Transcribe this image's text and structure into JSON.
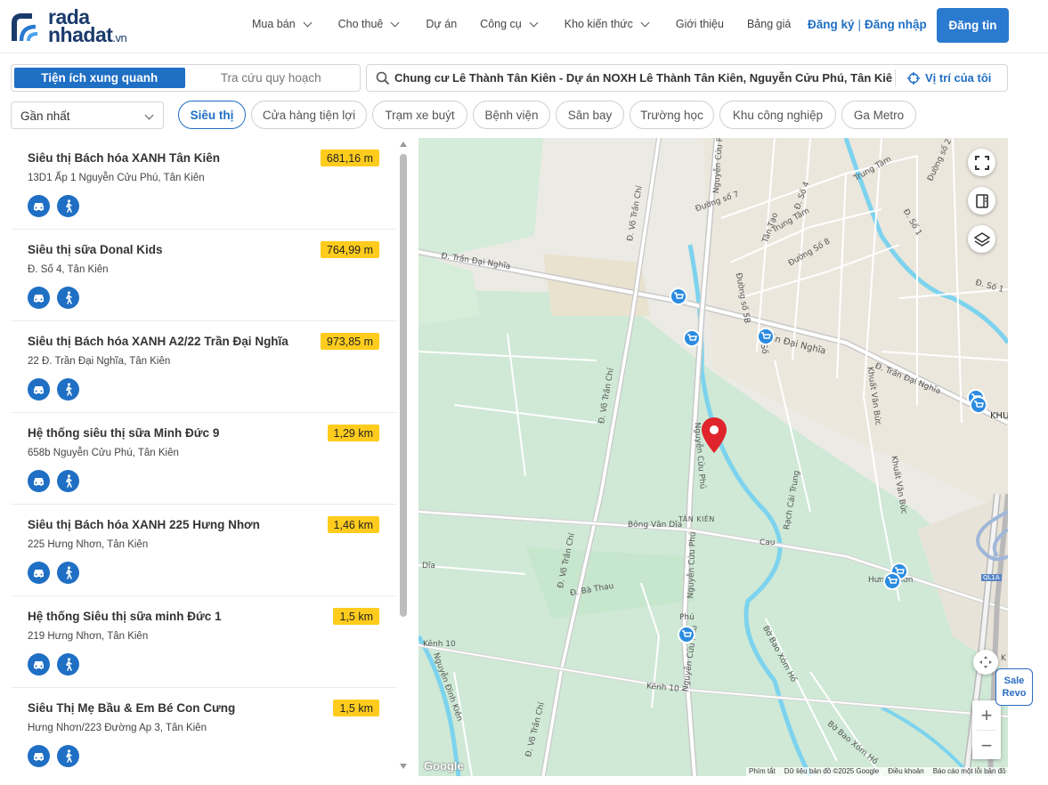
{
  "header": {
    "logo_line1": "rada",
    "logo_line2": "nhadat",
    "logo_suffix": ".vn",
    "nav": [
      {
        "label": "Mua bán",
        "has_dropdown": true
      },
      {
        "label": "Cho thuê",
        "has_dropdown": true
      },
      {
        "label": "Dự án",
        "has_dropdown": false
      },
      {
        "label": "Công cụ",
        "has_dropdown": true
      },
      {
        "label": "Kho kiến thức",
        "has_dropdown": true
      },
      {
        "label": "Giới thiệu",
        "has_dropdown": false
      },
      {
        "label": "Bảng giá",
        "has_dropdown": false
      }
    ],
    "register": "Đăng ký",
    "separator": "|",
    "login": "Đăng nhập",
    "post_button": "Đăng tin"
  },
  "toolbar": {
    "tab_active": "Tiện ích xung quanh",
    "tab_inactive": "Tra cứu quy hoạch",
    "search_value": "Chung cư Lê Thành Tân Kiên - Dự án NOXH Lê Thành Tân Kiên, Nguyễn Cửu Phú, Tân Kiên",
    "my_location": "Vị trí của tôi",
    "sort_value": "Gần nhất",
    "categories": [
      "Siêu thị",
      "Cửa hàng tiện lợi",
      "Trạm xe buýt",
      "Bệnh viện",
      "Sân bay",
      "Trường học",
      "Khu công nghiệp",
      "Ga Metro"
    ],
    "active_category": "Siêu thị"
  },
  "places": [
    {
      "name": "Siêu thị Bách hóa XANH Tân Kiên",
      "address": "13D1 Ấp 1 Nguyễn Cửu Phú, Tân Kiên",
      "distance": "681,16 m"
    },
    {
      "name": "Siêu thị sữa Donal Kids",
      "address": "Đ. Số 4, Tân Kiên",
      "distance": "764,99 m"
    },
    {
      "name": "Siêu thị Bách hóa XANH A2/22 Trần Đại Nghĩa",
      "address": "22 Đ. Trần Đại Nghĩa, Tân Kiên",
      "distance": "973,85 m"
    },
    {
      "name": "Hệ thống siêu thị sữa Minh Đức 9",
      "address": "658b Nguyễn Cửu Phú, Tân Kiên",
      "distance": "1,29 km"
    },
    {
      "name": "Siêu thị Bách hóa XANH 225 Hưng Nhơn",
      "address": "225 Hưng Nhơn, Tân Kiên",
      "distance": "1,46 km"
    },
    {
      "name": "Hệ thống Siêu thị sữa minh Đức 1",
      "address": "219 Hưng Nhơn, Tân Kiên",
      "distance": "1,5 km"
    },
    {
      "name": "Siêu Thị Mẹ Bầu & Em Bé Con Cưng",
      "address": "Hưng Nhơn/223 Đường Ap 3, Tân Kiên",
      "distance": "1,5 km"
    }
  ],
  "map": {
    "labels": {
      "tran_dai_nghia_w": "Đ. Trần Đại Nghĩa",
      "tran_dai_nghia_mid": "Trần Đại Nghĩa",
      "tran_dai_nghia_e": "Đ. Trần Đại Nghĩa",
      "vo_tran_chi_n": "Đ. Võ Trần Chí",
      "vo_tran_chi_m": "Đ. Võ Trần Chí",
      "vo_tran_chi_s1": "Đ. Võ Trần Chí",
      "vo_tran_chi_s2": "Đ. Võ Trần Chí",
      "nguyen_cuu_phu_n": "Nguyễn Cửu Phú",
      "nguyen_cuu_phu_m": "Nguyễn Cửu Phú",
      "nguyen_cuu_phu_s": "Nguyễn Cửu Phú",
      "nguyen_cuu_phu_s2": "Nguyễn Cửu Phú",
      "tan_kien": "TÂN KIÊN",
      "bong_van_dia": "Bông Văn Dĩa",
      "rach_cai_trung": "Rạch Cái Trung",
      "cau": "Cau",
      "hung_nhon": "Hưng Nhơn",
      "ba_thau": "Đ. Bà Thau",
      "kenh_10_a": "Kênh 10",
      "kenh_10_b": "Kênh 10",
      "nguyen_dinh_kien": "Nguyễn Đình Kiên",
      "bo_bao_xom_ho": "Bờ Bao Xóm Hố",
      "bo_bao_xom_ho2": "Bờ Bao Xóm Hồ",
      "khuat_van_buc": "Khuất Văn Bức",
      "khuat_van_buc2": "Khuất Văn Bức",
      "duong_so_7": "Đường số 7",
      "duong_so_8": "Đường Số 8",
      "duong_so_5b": "Đường số 5B",
      "duong_so_4": "Đ. Số 4",
      "tan_tao": "Tân Tạo",
      "trung_tam": "Trung Tâm",
      "trung_tam_ne": "Trung Tâm",
      "duong_so_2": "Đường số 2",
      "duong_so_1": "Đ. Số 1",
      "duong_so_1e": "Đ. Số 1",
      "khu": "KHU",
      "ql1a": "QL1A",
      "dia": "Dĩa",
      "so_3": "Số",
      "phu": "Phú",
      "kh_s": "K",
      "khu_s": "Kh"
    },
    "attribution": [
      "Phím tắt",
      "Dữ liệu bản đồ ©2025 Google",
      "Điều khoản",
      "Báo cáo một lỗi bản đồ"
    ],
    "google_logo": "Google",
    "zoom_in": "+",
    "zoom_out": "−"
  },
  "sale_widget": {
    "line1": "Sale",
    "line2": "Revo"
  },
  "colors": {
    "primary": "#1f6fc4",
    "distance_badge": "#ffcc1d",
    "pin": "#e0242b"
  },
  "icons": [
    "search-icon",
    "crosshair-icon",
    "car-icon",
    "walk-icon",
    "fullscreen-icon",
    "legend-icon",
    "layers-icon",
    "recenter-icon",
    "shopping-cart-icon",
    "location-pin-icon"
  ]
}
